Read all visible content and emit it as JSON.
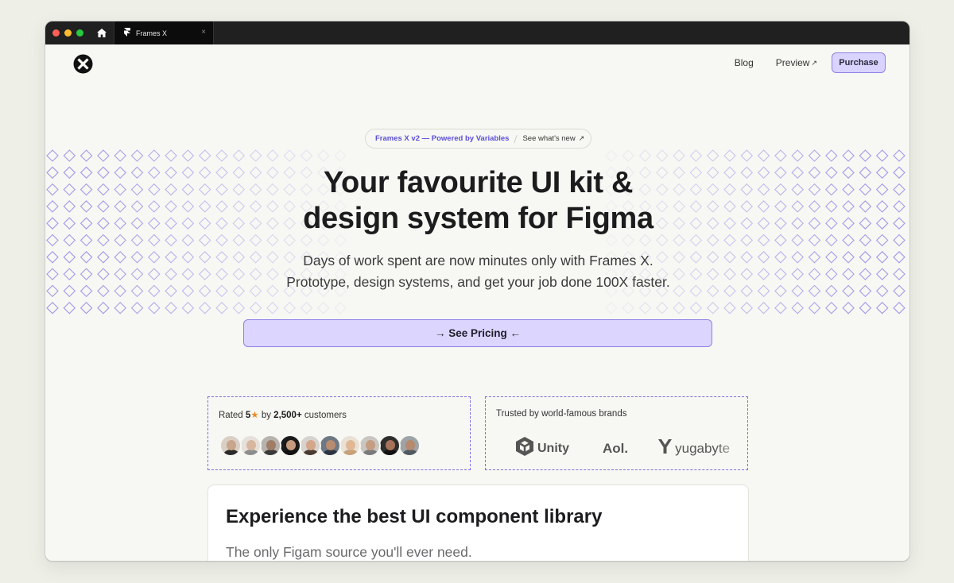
{
  "browser": {
    "tab_title": "Frames X",
    "tab_close": "×"
  },
  "nav": {
    "blog": "Blog",
    "preview": "Preview",
    "preview_arrow": "↗",
    "purchase": "Purchase"
  },
  "announcement": {
    "primary": "Frames X v2 — Powered by Variables",
    "secondary": "See what's new",
    "arrow": "↗"
  },
  "hero": {
    "title_line1": "Your favourite UI kit &",
    "title_line2": "design system for Figma",
    "subtitle_line1": "Days of work spent are now minutes only with Frames X.",
    "subtitle_line2": "Prototype, design systems, and get your job done 100X faster.",
    "cta": "→ See Pricing ←"
  },
  "rating": {
    "prefix": "Rated",
    "score": "5",
    "star": "★",
    "middle": "by",
    "count": "2,500+",
    "suffix": "customers",
    "avatar_count": 10
  },
  "brands": {
    "label": "Trusted by world-famous brands",
    "items": [
      "Unity",
      "Aol.",
      "yugabyte"
    ]
  },
  "feature": {
    "title": "Experience the best UI component library",
    "subtitle": "The only Figam source you'll ever need."
  },
  "colors": {
    "accent": "#5b4fd6",
    "accent_light": "#dcd6ff",
    "accent_border": "#8d80e8",
    "star": "#f08a24",
    "page_bg": "#f7f8f3"
  }
}
